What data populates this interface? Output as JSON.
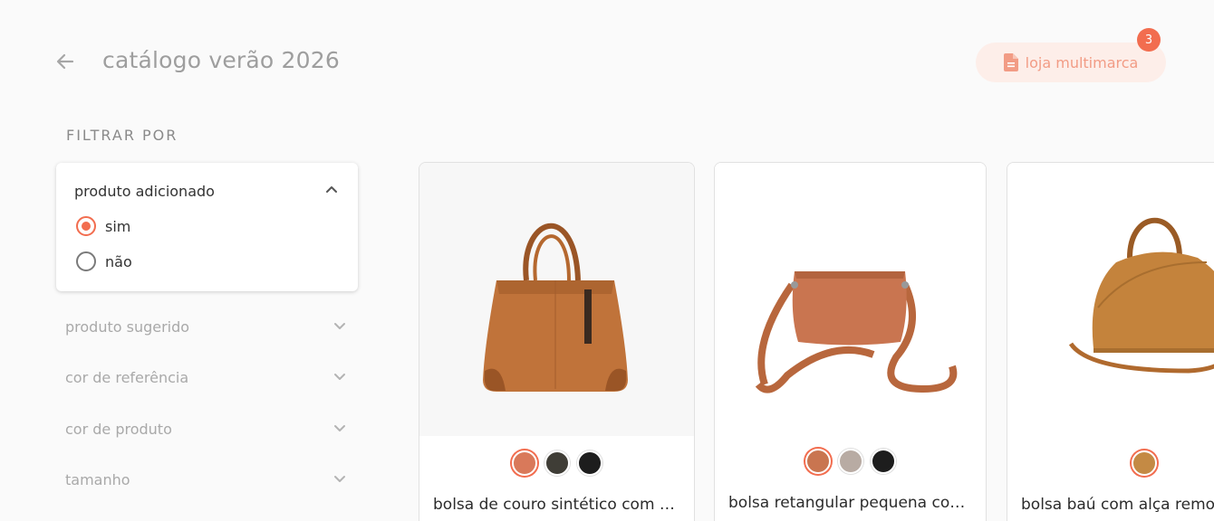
{
  "header": {
    "title": "catálogo verão 2026",
    "store_button_label": "loja multimarca",
    "badge_count": "3"
  },
  "filters": {
    "heading": "FILTRAR POR",
    "expanded": {
      "title": "produto adicionado",
      "options": [
        {
          "label": "sim",
          "selected": true
        },
        {
          "label": "não",
          "selected": false
        }
      ]
    },
    "collapsed": [
      {
        "label": "produto sugerido"
      },
      {
        "label": "cor de referência"
      },
      {
        "label": "cor de produto"
      },
      {
        "label": "tamanho"
      }
    ]
  },
  "products": [
    {
      "name": "bolsa de couro sintético com d…",
      "swatches": [
        "#d9795a",
        "#3f3d36",
        "#1d1d1d"
      ],
      "selected_swatch": 0
    },
    {
      "name": "bolsa retangular pequena com…",
      "swatches": [
        "#c97550",
        "#b8aba3",
        "#1d1d1d"
      ],
      "selected_swatch": 0
    },
    {
      "name": "bolsa baú com alça remov",
      "swatches": [
        "#c48a44"
      ],
      "selected_swatch": 0
    }
  ],
  "colors": {
    "accent": "#f26d4f",
    "store_button_bg": "#fdeee9",
    "store_button_text": "#f29c85"
  }
}
